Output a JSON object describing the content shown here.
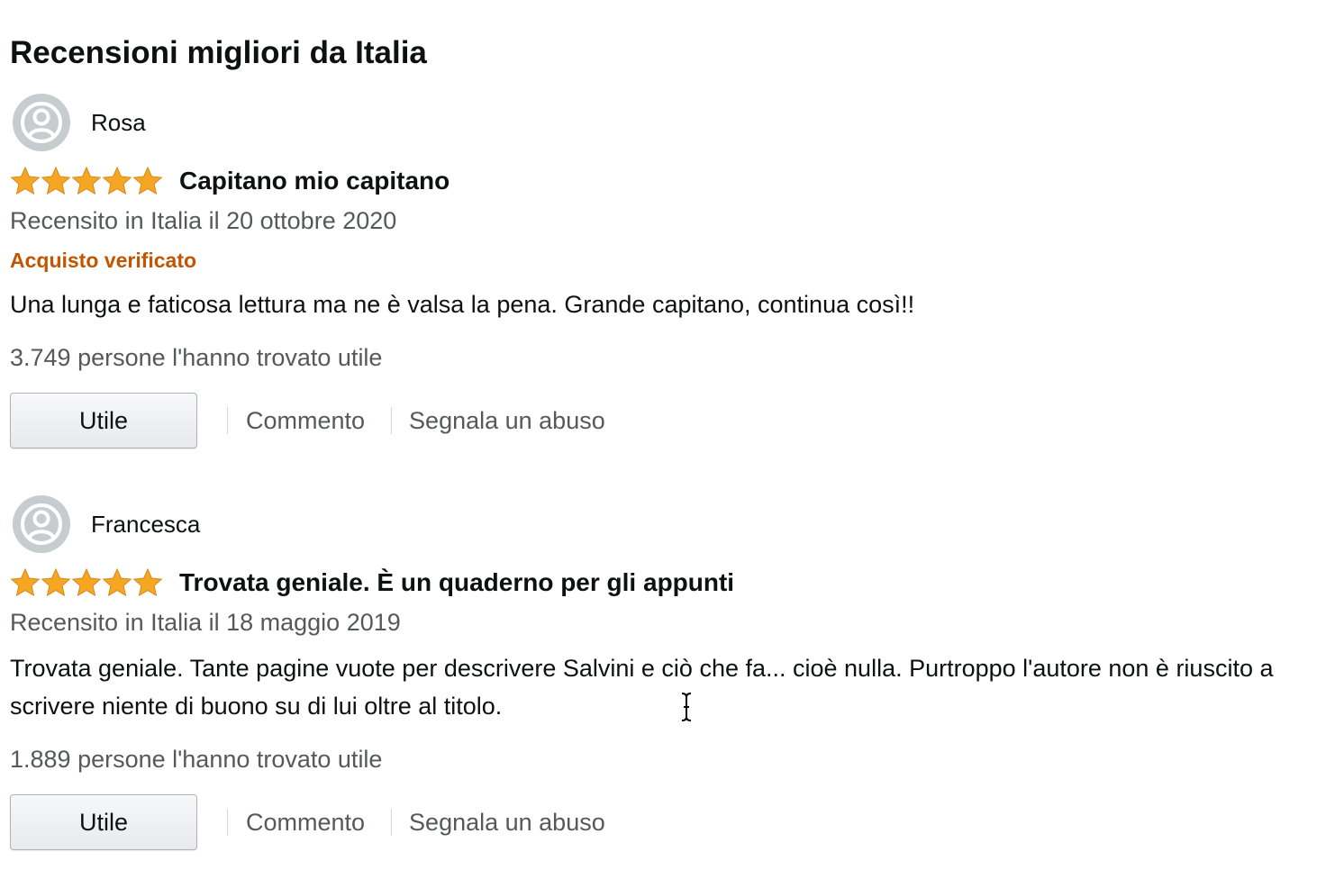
{
  "page": {
    "title": "Recensioni migliori da Italia"
  },
  "colors": {
    "star": "#f5a623",
    "verified": "#c45500",
    "muted_text": "#565959",
    "avatar_bg": "#d5dbdb"
  },
  "reviews": [
    {
      "author": "Rosa",
      "rating": 5,
      "title": "Capitano mio capitano",
      "date": "Recensito in Italia il 20 ottobre 2020",
      "verified": "Acquisto verificato",
      "body": "Una lunga e faticosa lettura ma ne è valsa la pena. Grande capitano, continua così!!",
      "helpful_count": "3.749 persone l'hanno trovato utile",
      "actions": {
        "helpful": "Utile",
        "comment": "Commento",
        "report": "Segnala un abuso"
      }
    },
    {
      "author": "Francesca",
      "rating": 5,
      "title": "Trovata geniale. È un quaderno per gli appunti",
      "date": "Recensito in Italia il 18 maggio 2019",
      "body": "Trovata geniale. Tante pagine vuote per descrivere Salvini e ciò che fa... cioè nulla. Purtroppo l'autore non è riuscito a scrivere niente di buono su di lui oltre al titolo.",
      "helpful_count": "1.889 persone l'hanno trovato utile",
      "actions": {
        "helpful": "Utile",
        "comment": "Commento",
        "report": "Segnala un abuso"
      }
    }
  ]
}
